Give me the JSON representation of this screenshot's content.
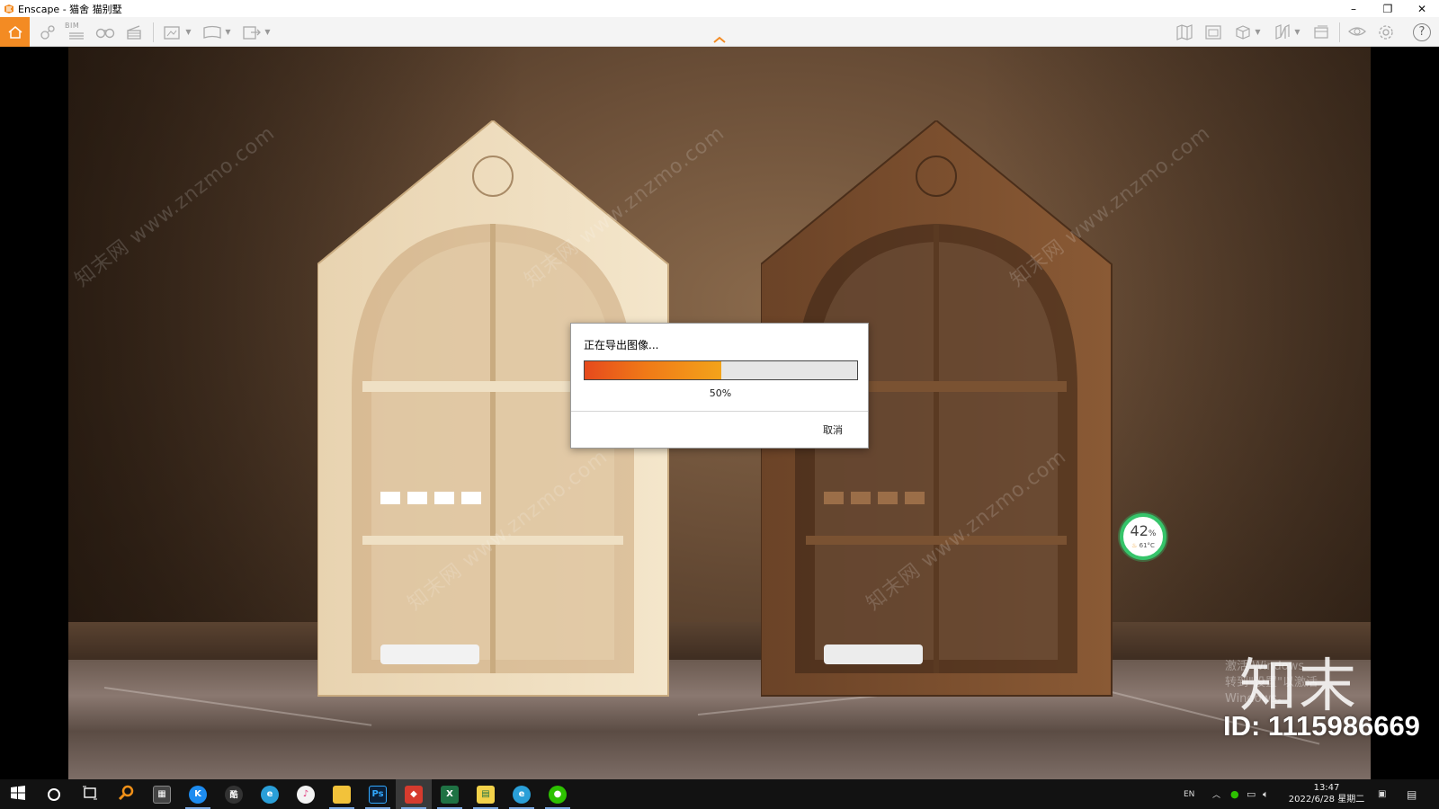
{
  "window": {
    "title": "Enscape - 猫舍 猫别墅",
    "controls": {
      "minimize": "–",
      "restore": "❐",
      "close": "✕"
    }
  },
  "toolbar": {
    "accent_color": "#f38b23",
    "bim_label": "BIM",
    "left_icons": [
      "home-icon",
      "location-icon",
      "bim-icon",
      "binoculars-icon",
      "clapper-icon",
      "screenshot-icon",
      "panorama-icon",
      "export-icon"
    ],
    "right_icons": [
      "map-icon",
      "asset-library-icon",
      "cube-icon",
      "book-icon",
      "layers-icon",
      "visual-settings-icon",
      "gear-icon",
      "help-icon"
    ],
    "help_glyph": "?"
  },
  "viewport": {
    "gpu_gauge": {
      "load": "42",
      "unit": "%",
      "temp": "61°C",
      "ring_color": "#35c46a"
    },
    "watermarks": {
      "site": "知末网 www.znzmo.com",
      "brand": "知末",
      "id_text": "ID: 1115986669",
      "activate_line1": "激活 Windows",
      "activate_line2": "转到\"设置\"以激活 Windows。"
    }
  },
  "dialog": {
    "title": "正在导出图像...",
    "progress": 0.5,
    "percent_label": "50%",
    "cancel_label": "取消",
    "progress_colors": [
      "#e64a1d",
      "#f3a31a"
    ]
  },
  "taskbar": {
    "apps": [
      {
        "name": "start",
        "label": ""
      },
      {
        "name": "search",
        "label": ""
      },
      {
        "name": "task-view",
        "label": ""
      },
      {
        "name": "magnifier",
        "label": ""
      },
      {
        "name": "calculator",
        "label": ""
      },
      {
        "name": "kugou",
        "label": "K"
      },
      {
        "name": "kujiale",
        "label": "酷"
      },
      {
        "name": "edge",
        "label": ""
      },
      {
        "name": "itunes",
        "label": ""
      },
      {
        "name": "file-explorer",
        "label": ""
      },
      {
        "name": "photoshop",
        "label": "Ps"
      },
      {
        "name": "sketchup",
        "label": ""
      },
      {
        "name": "excel",
        "label": "X"
      },
      {
        "name": "notes",
        "label": ""
      },
      {
        "name": "edge-2",
        "label": ""
      },
      {
        "name": "wechat",
        "label": ""
      }
    ],
    "tray": {
      "lang": "EN",
      "time": "13:47",
      "date": "2022/6/28 星期二"
    }
  }
}
